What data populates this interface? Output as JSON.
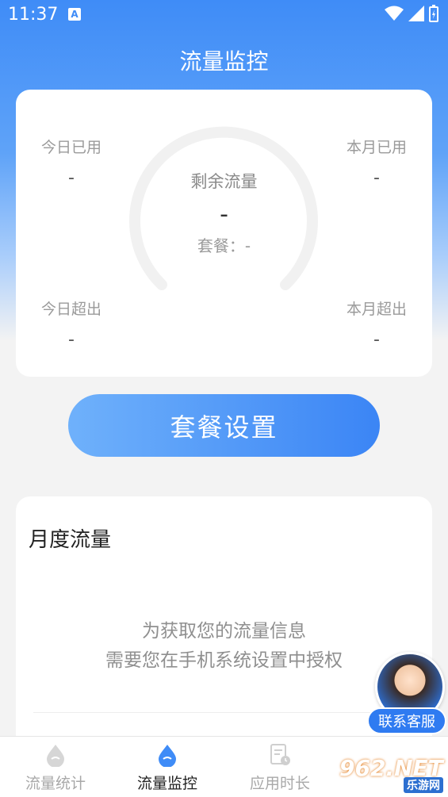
{
  "status_bar": {
    "time": "11:37",
    "notification_icon": "A"
  },
  "app": {
    "title": "流量监控"
  },
  "stats": {
    "today_used": {
      "label": "今日已用",
      "value": "-"
    },
    "month_used": {
      "label": "本月已用",
      "value": "-"
    },
    "today_over": {
      "label": "今日超出",
      "value": "-"
    },
    "month_over": {
      "label": "本月超出",
      "value": "-"
    }
  },
  "gauge": {
    "label": "剩余流量",
    "value": "-",
    "plan": "套餐：-"
  },
  "plan_button": {
    "label": "套餐设置"
  },
  "monthly": {
    "title": "月度流量",
    "hint_line1": "为获取您的流量信息",
    "hint_line2": "需要您在手机系统设置中授权"
  },
  "customer_service": {
    "label": "联系客服"
  },
  "bottom_nav": {
    "items": [
      {
        "label": "流量统计",
        "icon": "droplet-icon",
        "active": false
      },
      {
        "label": "流量监控",
        "icon": "droplet-icon",
        "active": true
      },
      {
        "label": "应用时长",
        "icon": "document-clock-icon",
        "active": false
      }
    ]
  },
  "watermark": {
    "main": "962.NET",
    "sub": "乐游网"
  },
  "colors": {
    "accent": "#3f8cf7",
    "button_start": "#6fb1fb",
    "button_end": "#3b85f5"
  }
}
